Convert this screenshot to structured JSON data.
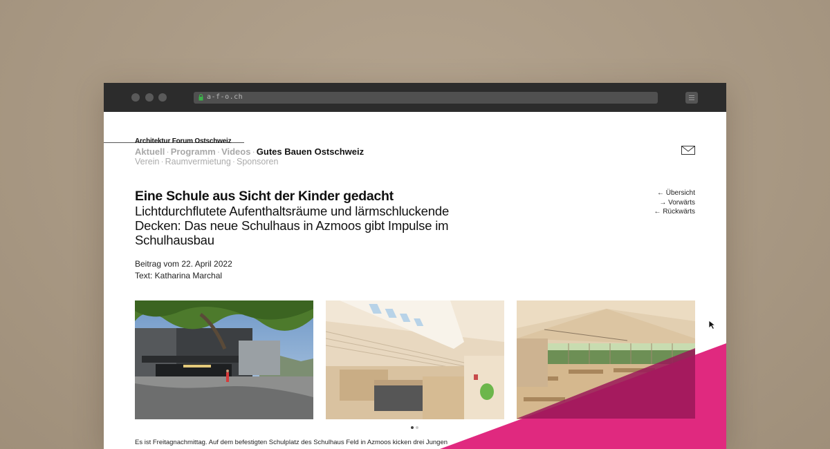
{
  "browser": {
    "url": "a-f-o.ch",
    "icons": {
      "lock": "lock-icon",
      "menu": "menu-icon"
    }
  },
  "header": {
    "brand": "Architektur Forum Ostschweiz",
    "nav_primary": [
      {
        "label": "Aktuell",
        "active": false
      },
      {
        "label": "Programm",
        "active": false
      },
      {
        "label": "Videos",
        "active": false
      },
      {
        "label": "Gutes Bauen Ostschweiz",
        "active": true
      }
    ],
    "nav_secondary": [
      {
        "label": "Verein"
      },
      {
        "label": "Raumvermietung"
      },
      {
        "label": "Sponsoren"
      }
    ],
    "separator": "·",
    "mail_icon": "mail-icon"
  },
  "article": {
    "title": "Eine Schule aus Sicht der Kinder gedacht",
    "subtitle": "Lichtdurchflutete Aufenthaltsräume und lärmschluckende Decken: Das neue Schulhaus in Azmoos gibt Impulse im Schulhausbau",
    "date": "Beitrag vom 22. April 2022",
    "author": "Text: Katharina Marchal",
    "body_start": "Es ist Freitagnachmittag. Auf dem befestigten Schulplatz des Schulhaus Feld in Azmoos kicken drei Jungen"
  },
  "side_nav": [
    {
      "label": "← Übersicht"
    },
    {
      "label": "→ Vorwärts"
    },
    {
      "label": "← Rückwärts"
    }
  ],
  "gallery": {
    "images": [
      {
        "name": "school-courtyard-photo"
      },
      {
        "name": "stairwell-skylight-photo"
      },
      {
        "name": "classroom-interior-photo"
      }
    ],
    "pages": 2,
    "current": 1
  },
  "colors": {
    "accent_magenta": "#e0297f",
    "browser_chrome": "#2c2c2c",
    "background": "#a89883"
  }
}
